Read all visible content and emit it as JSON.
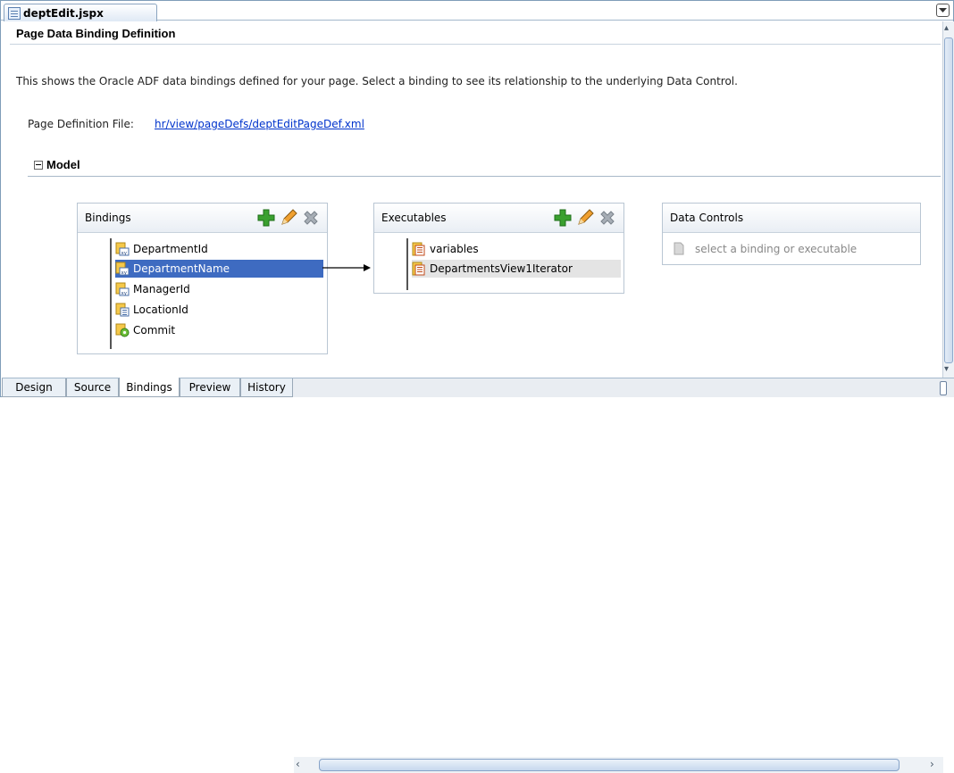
{
  "tab": {
    "file_name": "deptEdit.jspx"
  },
  "header": {
    "title": "Page Data Binding Definition",
    "description": "This shows the Oracle ADF data bindings defined for your page. Select a binding to see its relationship to the underlying Data Control."
  },
  "page_definition": {
    "label": "Page Definition File:",
    "link": "hr/view/pageDefs/deptEditPageDef.xml"
  },
  "model": {
    "label": "Model"
  },
  "bindings": {
    "title": "Bindings",
    "items": [
      {
        "label": "DepartmentId",
        "icon": "attribute-binding-icon",
        "selected": false
      },
      {
        "label": "DepartmentName",
        "icon": "attribute-binding-icon",
        "selected": true
      },
      {
        "label": "ManagerId",
        "icon": "attribute-binding-icon",
        "selected": false
      },
      {
        "label": "LocationId",
        "icon": "list-binding-icon",
        "selected": false
      },
      {
        "label": "Commit",
        "icon": "action-binding-icon",
        "selected": false
      }
    ]
  },
  "executables": {
    "title": "Executables",
    "items": [
      {
        "label": "variables",
        "icon": "executable-icon",
        "highlighted": false
      },
      {
        "label": "DepartmentsView1Iterator",
        "icon": "iterator-icon",
        "highlighted": true
      }
    ]
  },
  "data_controls": {
    "title": "Data Controls",
    "placeholder": "select a binding or executable"
  },
  "bottom_tabs": [
    {
      "label": "Design",
      "active": false
    },
    {
      "label": "Source",
      "active": false
    },
    {
      "label": "Bindings",
      "active": true
    },
    {
      "label": "Preview",
      "active": false
    },
    {
      "label": "History",
      "active": false
    }
  ],
  "colors": {
    "selection": "#3e6bc1",
    "link": "#0033cc",
    "add_icon": "#3aa02f"
  }
}
